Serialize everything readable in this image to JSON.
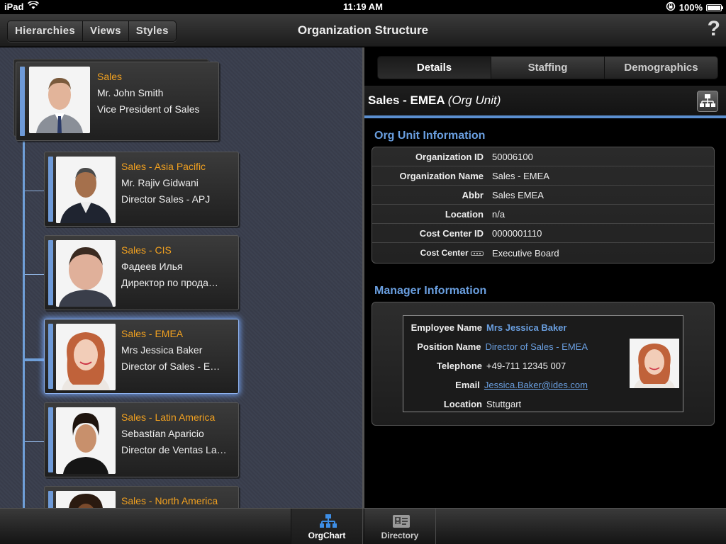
{
  "status": {
    "device": "iPad",
    "time": "11:19 AM",
    "battery": "100%",
    "battery_level": 1.0
  },
  "nav": {
    "segments": [
      "Hierarchies",
      "Views",
      "Styles"
    ],
    "title": "Organization Structure",
    "help": "?"
  },
  "tree": {
    "root": {
      "unit": "Sales",
      "name": "Mr. John Smith",
      "role": "Vice President of Sales"
    },
    "children": [
      {
        "unit": "Sales - Asia Pacific",
        "name": "Mr. Rajiv Gidwani",
        "role": "Director Sales - APJ"
      },
      {
        "unit": "Sales - CIS",
        "name": "Фадеев Илья",
        "role": "Директор по прода…"
      },
      {
        "unit": "Sales - EMEA",
        "name": "Mrs Jessica Baker",
        "role": "Director of Sales - E…"
      },
      {
        "unit": "Sales - Latin America",
        "name": "Sebastían Aparicio",
        "role": "Director de Ventas La…"
      },
      {
        "unit": "Sales - North America",
        "name": "",
        "role": ""
      }
    ],
    "selected_index": 2
  },
  "detail": {
    "tabs": [
      "Details",
      "Staffing",
      "Demographics"
    ],
    "active_tab": "Details",
    "title": "Sales - EMEA",
    "title_type": "(Org Unit)",
    "org_section_title": "Org Unit Information",
    "org_rows": [
      {
        "label": "Organization ID",
        "value": "50006100"
      },
      {
        "label": "Organization Name",
        "value": "Sales - EMEA"
      },
      {
        "label": "Abbr",
        "value": "Sales EMEA"
      },
      {
        "label": "Location",
        "value": "n/a"
      },
      {
        "label": "Cost Center ID",
        "value": "0000001110"
      },
      {
        "label": "Cost Center",
        "value": "Executive Board"
      }
    ],
    "manager_section_title": "Manager Information",
    "manager": {
      "employee_name_label": "Employee Name",
      "employee_name": "Mrs Jessica Baker",
      "position_label": "Position Name",
      "position": "Director of Sales - EMEA",
      "telephone_label": "Telephone",
      "telephone": "+49-711 12345 007",
      "email_label": "Email",
      "email": "Jessica.Baker@ides.com",
      "location_label": "Location",
      "location": "Stuttgart"
    }
  },
  "tabbar": {
    "items": [
      "OrgChart",
      "Directory"
    ],
    "active": "OrgChart"
  },
  "colors": {
    "accent": "#6a9fe0",
    "unit_orange": "#f0a020",
    "tree_line": "#6f9fd8"
  }
}
